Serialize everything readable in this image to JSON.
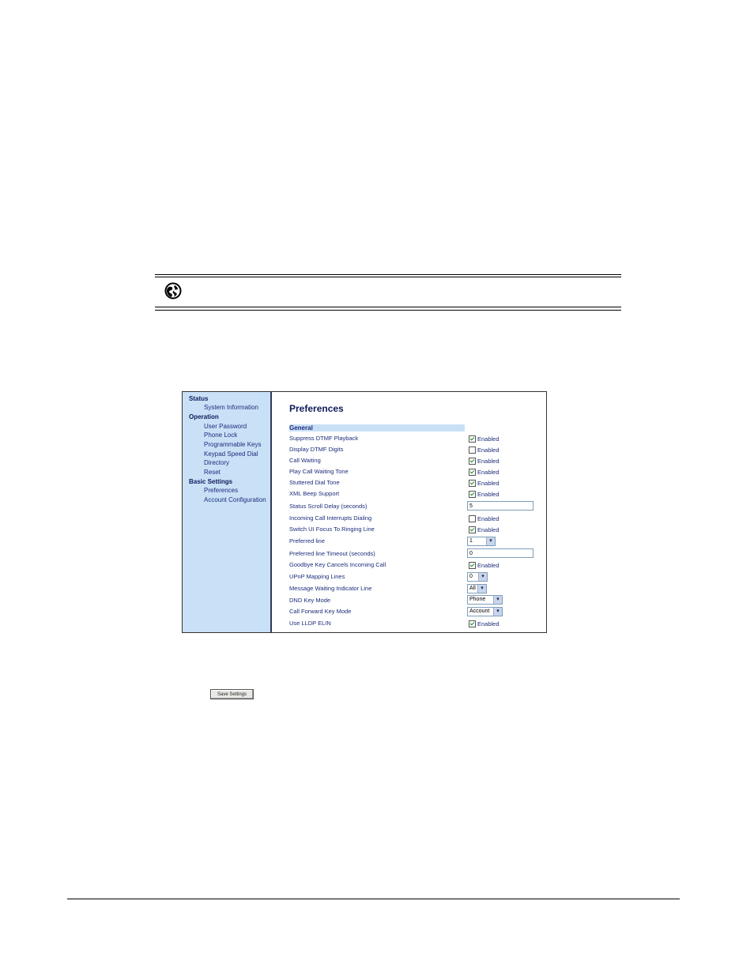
{
  "sidebar": {
    "status": "Status",
    "system_information": "System Information",
    "operation": "Operation",
    "user_password": "User Password",
    "phone_lock": "Phone Lock",
    "programmable_keys": "Programmable Keys",
    "keypad_speed_dial": "Keypad Speed Dial",
    "directory": "Directory",
    "reset": "Reset",
    "basic_settings": "Basic Settings",
    "preferences": "Preferences",
    "account_configuration": "Account Configuration"
  },
  "main": {
    "title": "Preferences",
    "section": "General",
    "enabled_label": "Enabled",
    "rows": {
      "suppress_dtmf": {
        "label": "Suppress DTMF Playback",
        "checked": true
      },
      "display_dtmf": {
        "label": "Display DTMF Digits",
        "checked": false
      },
      "call_waiting": {
        "label": "Call Waiting",
        "checked": true
      },
      "play_call_waiting_tone": {
        "label": "Play Call Waiting Tone",
        "checked": true
      },
      "stuttered_dial_tone": {
        "label": "Stuttered Dial Tone",
        "checked": true
      },
      "xml_beep_support": {
        "label": "XML Beep Support",
        "checked": true
      },
      "status_scroll_delay": {
        "label": "Status Scroll Delay (seconds)",
        "value": "5"
      },
      "incoming_call_interrupts": {
        "label": "Incoming Call Interrupts Dialing",
        "checked": false
      },
      "switch_ui_focus": {
        "label": "Switch UI Focus To Ringing Line",
        "checked": true
      },
      "preferred_line": {
        "label": "Preferred line",
        "value": "1"
      },
      "preferred_line_timeout": {
        "label": "Preferred line Timeout (seconds)",
        "value": "0"
      },
      "goodbye_key": {
        "label": "Goodbye Key Cancels Incoming Call",
        "checked": true
      },
      "upnp_mapping_lines": {
        "label": "UPnP Mapping Lines",
        "value": "0"
      },
      "mwi_line": {
        "label": "Message Waiting Indicator Line",
        "value": "All"
      },
      "dnd_key_mode": {
        "label": "DND Key Mode",
        "value": "Phone"
      },
      "call_forward_key_mode": {
        "label": "Call Forward Key Mode",
        "value": "Account"
      },
      "use_lldp_elin": {
        "label": "Use LLDP ELIN",
        "checked": true
      }
    }
  },
  "save_button": "Save Settings",
  "icons": {
    "note": "globe-icon",
    "dropdown": "chevron-down-icon"
  },
  "colors": {
    "sidebar_bg": "#c9e1f7",
    "link_text": "#1c2c7a",
    "check": "#1a8a1a"
  }
}
